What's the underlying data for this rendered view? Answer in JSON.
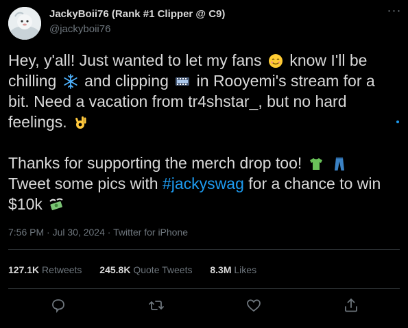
{
  "author": {
    "display_name": "JackyBoii76 (Rank #1 Clipper @ C9)",
    "handle": "@jackyboii76"
  },
  "menu": {
    "more_icon": "more-dots-icon",
    "more_label": "···"
  },
  "tweet": {
    "line1a": "Hey, y'all! Just wanted to let my fans",
    "line1b": "know I'll be",
    "line2a": "chilling",
    "line2b": "and clipping",
    "line2c": "in Rooyemi's stream for a",
    "line3": "bit. Need a vacation from tr4shstar_, but no hard",
    "line4": "feelings.",
    "line5": "Thanks for supporting the merch drop too!",
    "line6a": "Tweet some pics with",
    "hashtag": "#jackyswag",
    "line6b": "for a chance to win",
    "line7": "$10k",
    "emojis": [
      "smiling-face-emoji",
      "snowflake-emoji",
      "film-frames-emoji",
      "ok-hand-emoji",
      "t-shirt-emoji",
      "jeans-emoji",
      "money-with-wings-emoji"
    ]
  },
  "meta": {
    "time": "7:56 PM",
    "date": "Jul 30, 2024",
    "source": "Twitter for iPhone",
    "sep": "·"
  },
  "stats": {
    "retweets_count": "127.1K",
    "retweets_label": "Retweets",
    "quotes_count": "245.8K",
    "quotes_label": "Quote Tweets",
    "likes_count": "8.3M",
    "likes_label": "Likes"
  },
  "actions": [
    "reply-icon",
    "retweet-icon",
    "like-icon",
    "share-icon"
  ],
  "colors": {
    "background": "#000000",
    "text": "#d9d9d9",
    "muted": "#6e767d",
    "link": "#1d9bf0",
    "divider": "#2f3336"
  }
}
